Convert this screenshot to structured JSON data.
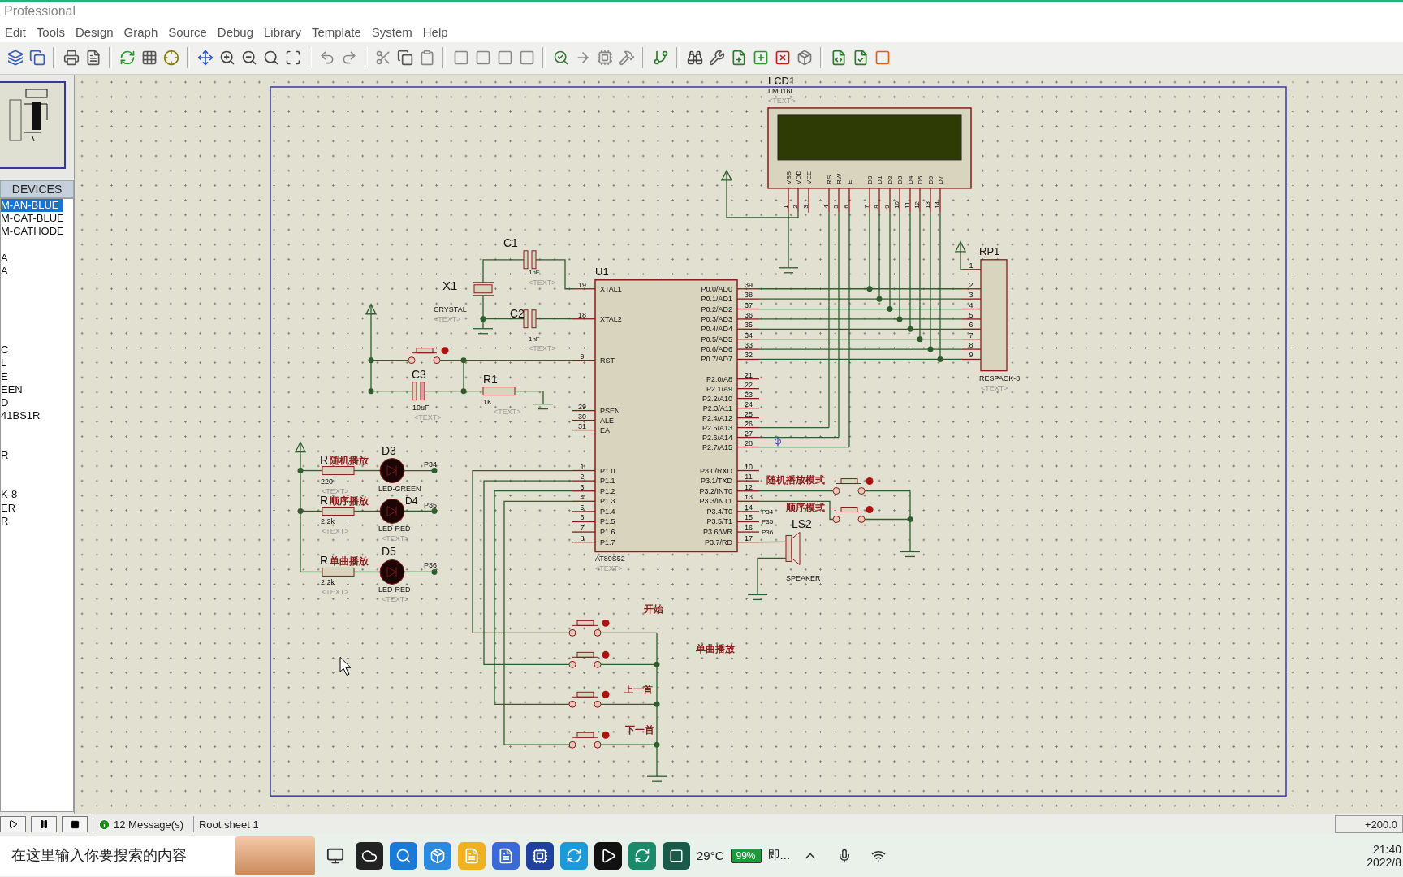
{
  "window": {
    "title": "Professional"
  },
  "menu": [
    "Edit",
    "Tools",
    "Design",
    "Graph",
    "Source",
    "Debug",
    "Library",
    "Template",
    "System",
    "Help"
  ],
  "devices": {
    "header": "DEVICES",
    "items": [
      {
        "label": "M-AN-BLUE",
        "selected": true
      },
      {
        "label": "M-CAT-BLUE",
        "selected": false
      },
      {
        "label": "M-CATHODE",
        "selected": false
      },
      {
        "label": "A",
        "selected": false
      },
      {
        "label": "A",
        "selected": false
      },
      {
        "label": "C",
        "selected": false
      },
      {
        "label": "L",
        "selected": false
      },
      {
        "label": "E",
        "selected": false
      },
      {
        "label": "EEN",
        "selected": false
      },
      {
        "label": "D",
        "selected": false
      },
      {
        "label": "41BS1R",
        "selected": false
      },
      {
        "label": "R",
        "selected": false
      },
      {
        "label": "K-8",
        "selected": false
      },
      {
        "label": "ER",
        "selected": false
      },
      {
        "label": "R",
        "selected": false
      }
    ]
  },
  "schematic": {
    "lcd": {
      "ref": "LCD1",
      "type": "LM016L",
      "text": "<TEXT>",
      "pins": [
        {
          "name": "VSS",
          "number": "1"
        },
        {
          "name": "VDD",
          "number": "2"
        },
        {
          "name": "VEE",
          "number": "3"
        },
        {
          "name": "RS",
          "number": "4"
        },
        {
          "name": "RW",
          "number": "5"
        },
        {
          "name": "E",
          "number": "6"
        },
        {
          "name": "D0",
          "number": "7"
        },
        {
          "name": "D1",
          "number": "8"
        },
        {
          "name": "D2",
          "number": "9"
        },
        {
          "name": "D3",
          "number": "10"
        },
        {
          "name": "D4",
          "number": "11"
        },
        {
          "name": "D5",
          "number": "12"
        },
        {
          "name": "D6",
          "number": "13"
        },
        {
          "name": "D7",
          "number": "14"
        }
      ]
    },
    "mcu": {
      "ref": "U1",
      "type": "AT89S52",
      "text": "<TEXT>",
      "left_pins": [
        {
          "name": "XTAL1",
          "number": "19"
        },
        {
          "name": "XTAL2",
          "number": "18"
        },
        {
          "name": "RST",
          "number": "9"
        },
        {
          "name": "PSEN",
          "number": "29"
        },
        {
          "name": "ALE",
          "number": "30"
        },
        {
          "name": "EA",
          "number": "31"
        },
        {
          "name": "P1.0",
          "number": "1"
        },
        {
          "name": "P1.1",
          "number": "2"
        },
        {
          "name": "P1.2",
          "number": "3"
        },
        {
          "name": "P1.3",
          "number": "4"
        },
        {
          "name": "P1.4",
          "number": "5"
        },
        {
          "name": "P1.5",
          "number": "6"
        },
        {
          "name": "P1.6",
          "number": "7"
        },
        {
          "name": "P1.7",
          "number": "8"
        }
      ],
      "right_pins": [
        {
          "name": "P0.0/AD0",
          "number": "39"
        },
        {
          "name": "P0.1/AD1",
          "number": "38"
        },
        {
          "name": "P0.2/AD2",
          "number": "37"
        },
        {
          "name": "P0.3/AD3",
          "number": "36"
        },
        {
          "name": "P0.4/AD4",
          "number": "35"
        },
        {
          "name": "P0.5/AD5",
          "number": "34"
        },
        {
          "name": "P0.6/AD6",
          "number": "33"
        },
        {
          "name": "P0.7/AD7",
          "number": "32"
        },
        {
          "name": "P2.0/A8",
          "number": "21"
        },
        {
          "name": "P2.1/A9",
          "number": "22"
        },
        {
          "name": "P2.2/A10",
          "number": "23"
        },
        {
          "name": "P2.3/A11",
          "number": "24"
        },
        {
          "name": "P2.4/A12",
          "number": "25"
        },
        {
          "name": "P2.5/A13",
          "number": "26"
        },
        {
          "name": "P2.6/A14",
          "number": "27"
        },
        {
          "name": "P2.7/A15",
          "number": "28"
        },
        {
          "name": "P3.0/RXD",
          "number": "10"
        },
        {
          "name": "P3.1/TXD",
          "number": "11"
        },
        {
          "name": "P3.2/INT0",
          "number": "12"
        },
        {
          "name": "P3.3/INT1",
          "number": "13"
        },
        {
          "name": "P3.4/T0",
          "number": "14"
        },
        {
          "name": "P3.5/T1",
          "number": "15"
        },
        {
          "name": "P3.6/WR",
          "number": "16"
        },
        {
          "name": "P3.7/RD",
          "number": "17"
        }
      ]
    },
    "resistor_pack": {
      "ref": "RP1",
      "type": "RESPACK-8",
      "text": "<TEXT>",
      "pins": [
        "1",
        "2",
        "3",
        "4",
        "5",
        "6",
        "7",
        "8",
        "9"
      ]
    },
    "crystal": {
      "ref": "X1",
      "type": "CRYSTAL",
      "text": "<TEXT>"
    },
    "capacitors": [
      {
        "ref": "C1",
        "value": "1nF",
        "text": "<TEXT>"
      },
      {
        "ref": "C2",
        "value": "1nF",
        "text": "<TEXT>"
      },
      {
        "ref": "C3",
        "value": "10uF",
        "text": "<TEXT>"
      }
    ],
    "reset_resistor": {
      "ref": "R1",
      "value": "1K",
      "text": "<TEXT>"
    },
    "indicators": [
      {
        "resistor_ref": "R",
        "label": "随机播放",
        "value": "220",
        "resistor_text": "<TEXT>",
        "led_ref": "D3",
        "led_type": "LED-GREEN",
        "net": "P34"
      },
      {
        "resistor_ref": "R",
        "label": "顺序播放",
        "value": "2.2k",
        "resistor_text": "<TEXT>",
        "led_ref": "D4",
        "led_type": "LED-RED",
        "led_text": "<TEXT>",
        "net": "P35"
      },
      {
        "resistor_ref": "R",
        "label": "单曲播放",
        "value": "2.2k",
        "resistor_text": "<TEXT>",
        "led_ref": "D5",
        "led_type": "LED-RED",
        "led_text": "<TEXT>",
        "net": "P36"
      }
    ],
    "key_buttons": [
      {
        "label": "开始"
      },
      {
        "label": "单曲播放"
      },
      {
        "label": "上一首"
      },
      {
        "label": "下一首"
      }
    ],
    "mode_buttons": [
      {
        "label": "随机播放模式"
      },
      {
        "label": "顺序模式"
      }
    ],
    "speaker": {
      "ref": "LS2",
      "type": "SPEAKER"
    },
    "port3_nets": [
      "P34",
      "P35",
      "P36"
    ]
  },
  "status_bar": {
    "messages": "12 Message(s)",
    "sheet": "Root sheet 1",
    "zoom": "+200.0"
  },
  "taskbar": {
    "search_placeholder": "在这里输入你要搜索的内容",
    "weather": "29°C",
    "battery": "99%",
    "app_label": "即...",
    "time": "21:40",
    "date": "2022/8"
  }
}
